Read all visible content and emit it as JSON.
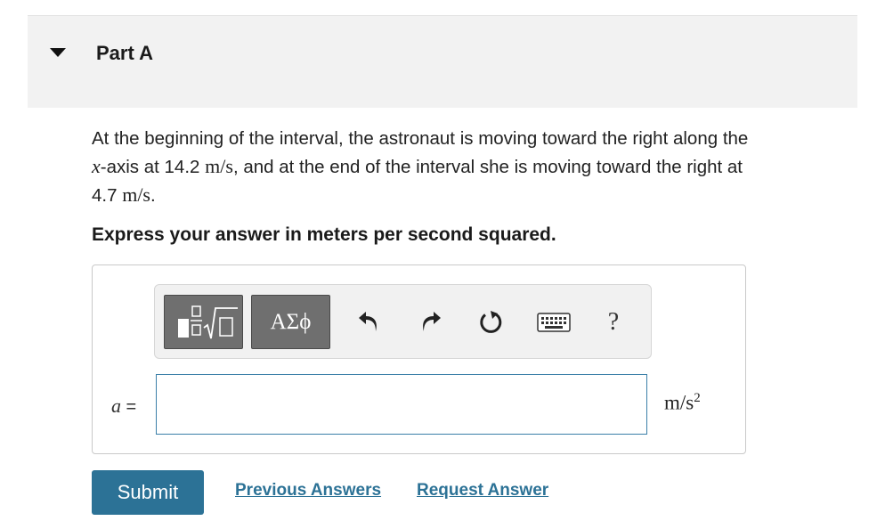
{
  "part": {
    "title": "Part A"
  },
  "question": {
    "t1": "At the beginning of the interval, the astronaut is moving toward the right along the",
    "axis_var": "x",
    "t2": "-axis at 14.2 ",
    "v1_units": "m/s",
    "t3": ", and at the end of the interval she is moving toward the right at",
    "t4": "4.7 ",
    "v2_units": "m/s",
    "t5": "."
  },
  "instruction": "Express your answer in meters per second squared.",
  "toolbar": {
    "templates_icon": "fraction-sqrt-template-icon",
    "greek_label": "ΑΣϕ",
    "undo_icon": "undo-icon",
    "redo_icon": "redo-icon",
    "reset_icon": "reset-icon",
    "keyboard_icon": "keyboard-icon",
    "help_label": "?"
  },
  "answer": {
    "variable": "a",
    "equals": " =",
    "value": "",
    "units_base": "m/s",
    "units_exp": "2"
  },
  "actions": {
    "submit_label": "Submit",
    "previous_label": "Previous Answers",
    "request_label": "Request Answer"
  },
  "colors": {
    "accent": "#2c7296",
    "input_border": "#3b7fa8",
    "toolbar_button": "#6f6f6f"
  }
}
